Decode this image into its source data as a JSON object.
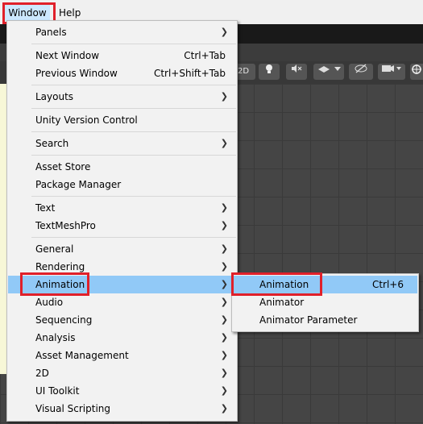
{
  "menubar": {
    "items": [
      "Window",
      "Help"
    ]
  },
  "scene_toolbar": {
    "mode_2d": "2D"
  },
  "window_menu": {
    "items": [
      {
        "label": "Panels",
        "shortcut": "",
        "submenu": true
      },
      {
        "label": "Next Window",
        "shortcut": "Ctrl+Tab",
        "submenu": false
      },
      {
        "label": "Previous Window",
        "shortcut": "Ctrl+Shift+Tab",
        "submenu": false
      },
      {
        "label": "Layouts",
        "shortcut": "",
        "submenu": true
      },
      {
        "label": "Unity Version Control",
        "shortcut": "",
        "submenu": false
      },
      {
        "label": "Search",
        "shortcut": "",
        "submenu": true
      },
      {
        "label": "Asset Store",
        "shortcut": "",
        "submenu": false
      },
      {
        "label": "Package Manager",
        "shortcut": "",
        "submenu": false
      },
      {
        "label": "Text",
        "shortcut": "",
        "submenu": true
      },
      {
        "label": "TextMeshPro",
        "shortcut": "",
        "submenu": true
      },
      {
        "label": "General",
        "shortcut": "",
        "submenu": true
      },
      {
        "label": "Rendering",
        "shortcut": "",
        "submenu": true
      },
      {
        "label": "Animation",
        "shortcut": "",
        "submenu": true,
        "selected": true
      },
      {
        "label": "Audio",
        "shortcut": "",
        "submenu": true
      },
      {
        "label": "Sequencing",
        "shortcut": "",
        "submenu": true
      },
      {
        "label": "Analysis",
        "shortcut": "",
        "submenu": true
      },
      {
        "label": "Asset Management",
        "shortcut": "",
        "submenu": true
      },
      {
        "label": "2D",
        "shortcut": "",
        "submenu": true
      },
      {
        "label": "UI Toolkit",
        "shortcut": "",
        "submenu": true
      },
      {
        "label": "Visual Scripting",
        "shortcut": "",
        "submenu": true
      }
    ]
  },
  "animation_submenu": {
    "items": [
      {
        "label": "Animation",
        "shortcut": "Ctrl+6",
        "selected": true
      },
      {
        "label": "Animator",
        "shortcut": ""
      },
      {
        "label": "Animator Parameter",
        "shortcut": ""
      }
    ]
  },
  "colors": {
    "highlight": "#e0202a",
    "selected": "#91c9f7",
    "menu_bg": "#f2f2f2"
  },
  "icons": [
    "chevron-right-icon",
    "lightbulb-icon",
    "audio-mute-icon",
    "effects-icon",
    "hidden-eye-icon",
    "camera-icon",
    "gizmo-icon"
  ]
}
